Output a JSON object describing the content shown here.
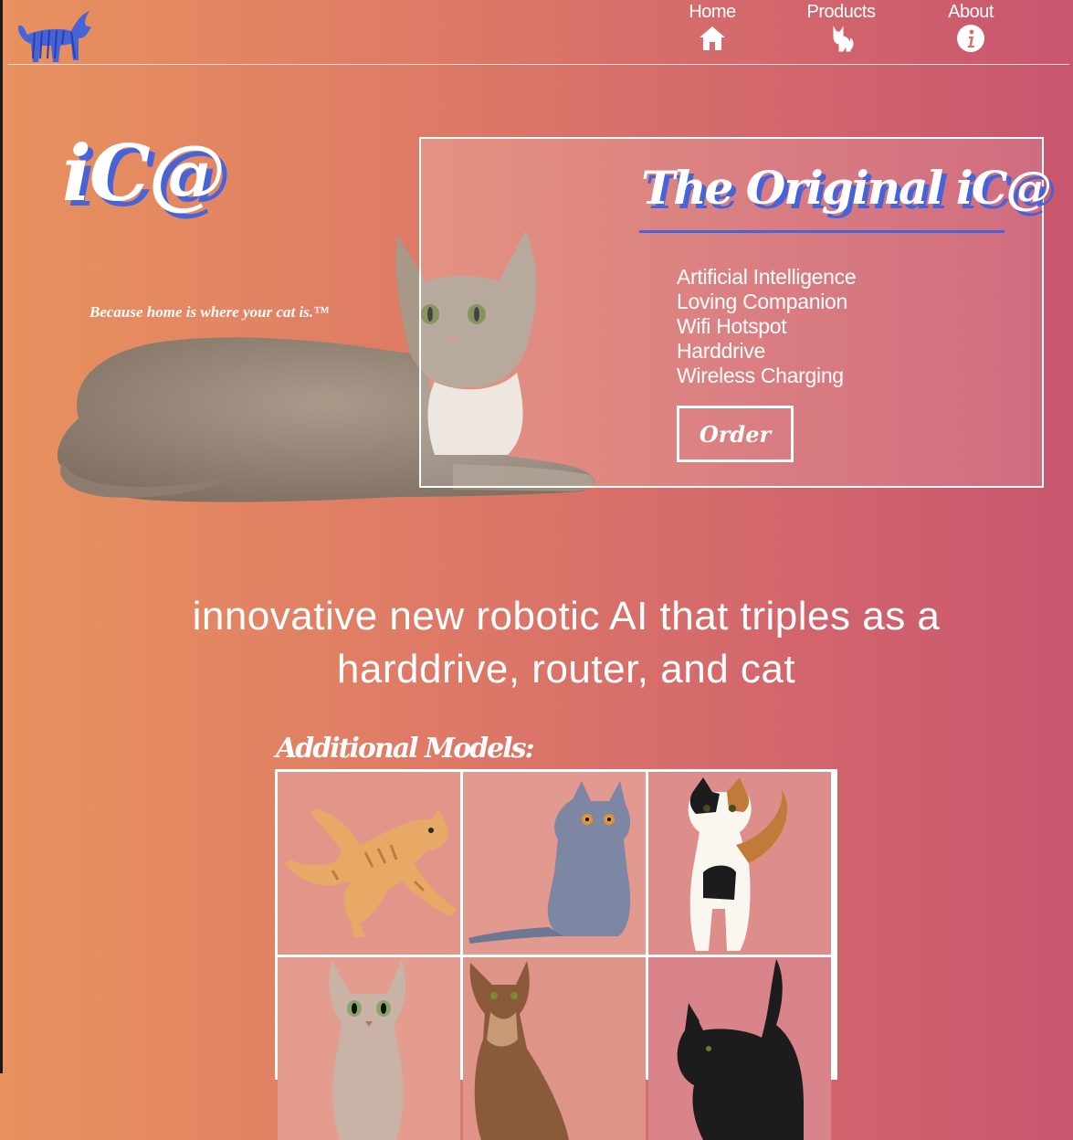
{
  "header": {
    "logo": "striped-cat-logo",
    "nav": [
      {
        "label": "Home",
        "icon": "home-icon"
      },
      {
        "label": "Products",
        "icon": "cat-icon"
      },
      {
        "label": "About",
        "icon": "info-icon"
      }
    ]
  },
  "hero": {
    "brand": "iC@",
    "tagline": "Because home is where your cat is.™",
    "product_title": "The Original iC@",
    "features": [
      "Artificial Intelligence",
      "Loving Companion",
      "Wifi Hotspot",
      "Harddrive",
      "Wireless Charging"
    ],
    "order_label": "Order"
  },
  "slogan": "innovative new robotic AI that triples as a harddrive, router, and cat",
  "models": {
    "heading": "Additional Models:",
    "items": [
      "orange-tabby-cat",
      "gray-british-shorthair-cat",
      "calico-cat",
      "sphynx-cat",
      "abyssinian-cat",
      "black-cat"
    ]
  },
  "colors": {
    "accent": "#4763d8",
    "gradient_start": "#e8925f",
    "gradient_end": "#c8566e"
  }
}
